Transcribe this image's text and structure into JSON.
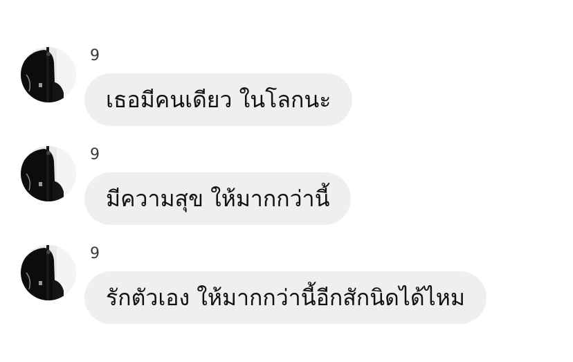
{
  "messages": [
    {
      "sender": "9",
      "text": "เธอมีคนเดียว ในโลกนะ"
    },
    {
      "sender": "9",
      "text": "มีความสุข ให้มากกว่านี้"
    },
    {
      "sender": "9",
      "text": "รักตัวเอง ให้มากกว่านี้อีกสักนิดได้ไหม"
    }
  ]
}
